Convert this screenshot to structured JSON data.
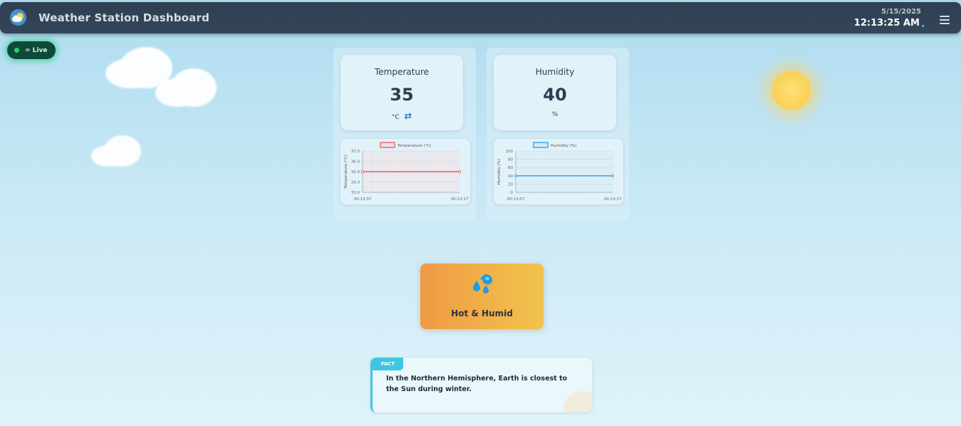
{
  "header": {
    "title": "Weather Station Dashboard",
    "date": "5/15/2025",
    "time": "12:13:25 AM"
  },
  "status": {
    "live_label": "= Live"
  },
  "temperature": {
    "title": "Temperature",
    "value": "35",
    "unit": "°C"
  },
  "humidity": {
    "title": "Humidity",
    "value": "40",
    "unit": "%"
  },
  "condition": {
    "label": "Hot & Humid",
    "icon": "water-drops-icon"
  },
  "fact": {
    "tag": "FACT",
    "text": "In the Northern Hemisphere, Earth is closest to the Sun during winter."
  },
  "colors": {
    "temperature_line": "#e8595d",
    "humidity_line": "#2a9ae0",
    "live_dot": "#2ecc71",
    "fact_accent": "#3ec6e0"
  },
  "chart_data": [
    {
      "type": "line",
      "legend": "Temperature (°C)",
      "ylabel": "Temperature (°C)",
      "xlabel": "",
      "ylim": [
        33.0,
        37.0
      ],
      "y_ticks": [
        "37.0",
        "36.0",
        "35.0",
        "34.0",
        "33.0"
      ],
      "x_ticks": [
        "00:13:07",
        "00:13:17"
      ],
      "series": [
        {
          "name": "Temperature (°C)",
          "x": [
            "00:13:07",
            "00:13:17"
          ],
          "values": [
            35,
            35
          ]
        }
      ]
    },
    {
      "type": "line",
      "legend": "Humidity (%)",
      "ylabel": "Humidity (%)",
      "xlabel": "",
      "ylim": [
        0,
        100
      ],
      "y_ticks": [
        "100",
        "80",
        "60",
        "40",
        "20",
        "0"
      ],
      "x_ticks": [
        "00:13:07",
        "00:13:17"
      ],
      "series": [
        {
          "name": "Humidity (%)",
          "x": [
            "00:13:07",
            "00:13:17"
          ],
          "values": [
            40,
            40
          ]
        }
      ]
    }
  ]
}
